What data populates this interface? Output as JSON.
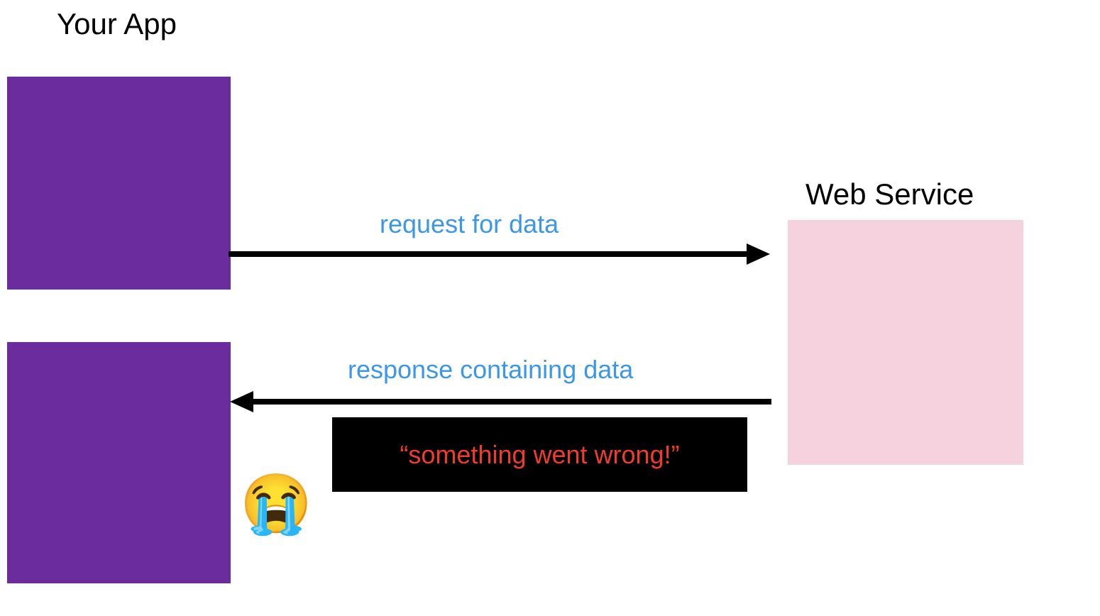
{
  "labels": {
    "your_app": "Your App",
    "web_service": "Web Service",
    "request": "request for data",
    "response": "response containing data",
    "error": "“something went wrong!”"
  },
  "emoji": {
    "crying": "😭"
  },
  "colors": {
    "purple": "#6b2d9e",
    "pink": "#f5d2de",
    "blue_text": "#3c97e8",
    "red_text": "#f13c2b",
    "black": "#000000"
  }
}
